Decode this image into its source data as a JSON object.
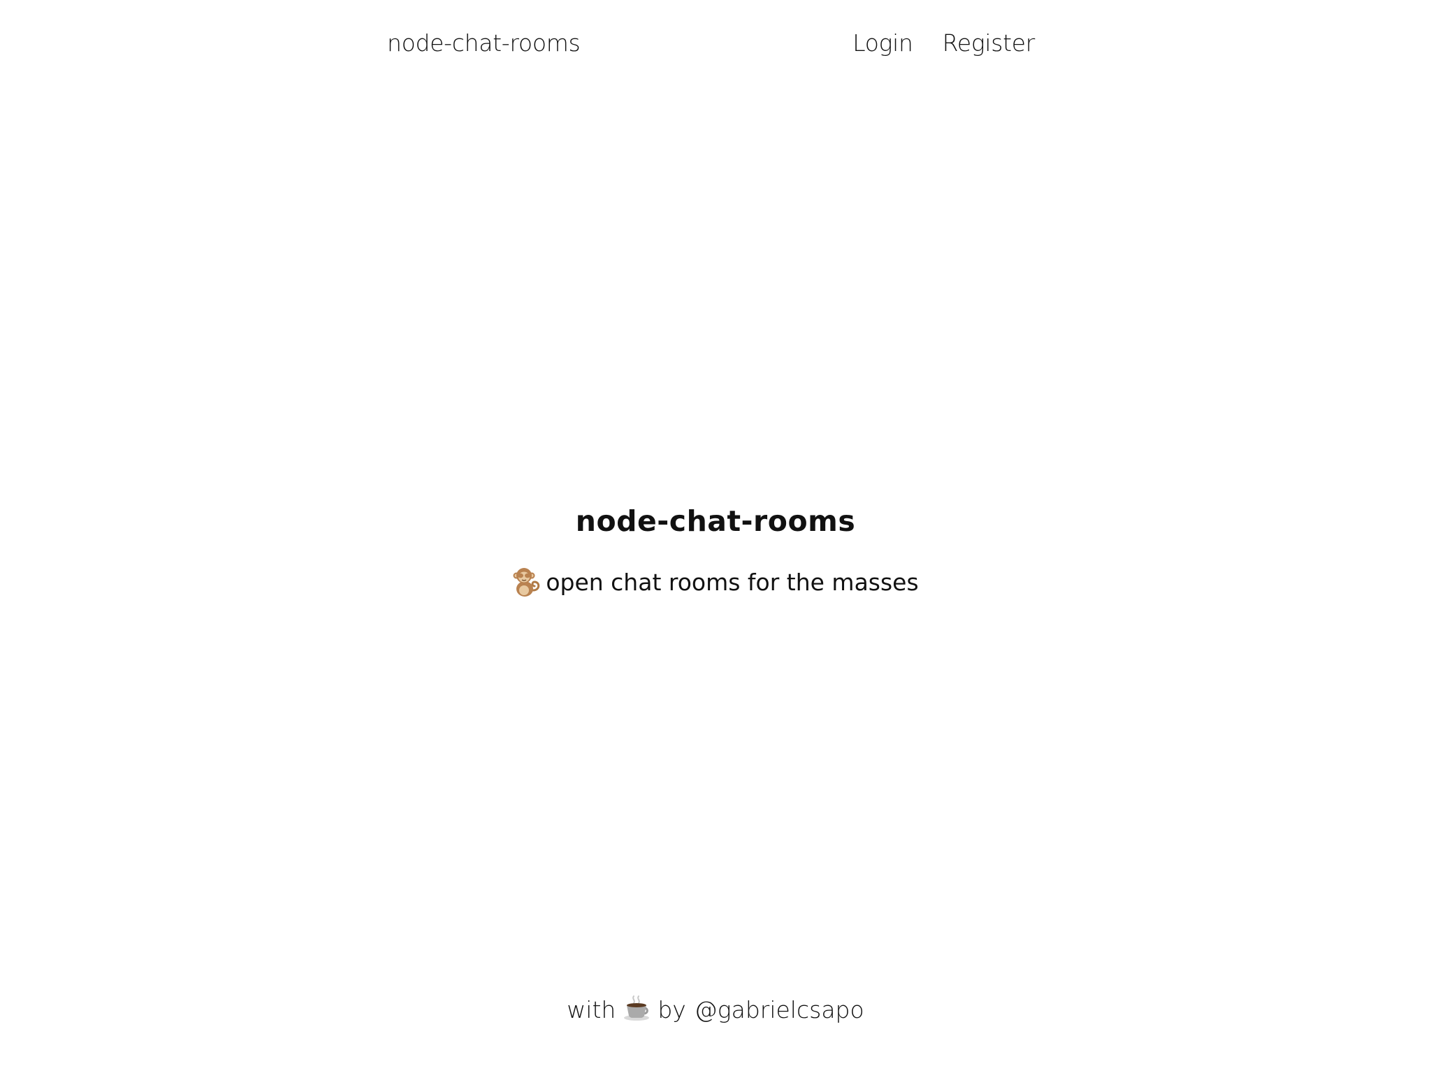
{
  "header": {
    "brand": "node-chat-rooms",
    "nav": {
      "login": "Login",
      "register": "Register"
    }
  },
  "hero": {
    "title": "node-chat-rooms",
    "tagline": "open chat rooms for the masses",
    "tagline_icon": "monkey-icon"
  },
  "footer": {
    "prefix": "with",
    "icon": "coffee-icon",
    "by": "by",
    "handle": "@gabrielcsapo"
  },
  "colors": {
    "background": "#ffffff",
    "text": "#111111"
  }
}
